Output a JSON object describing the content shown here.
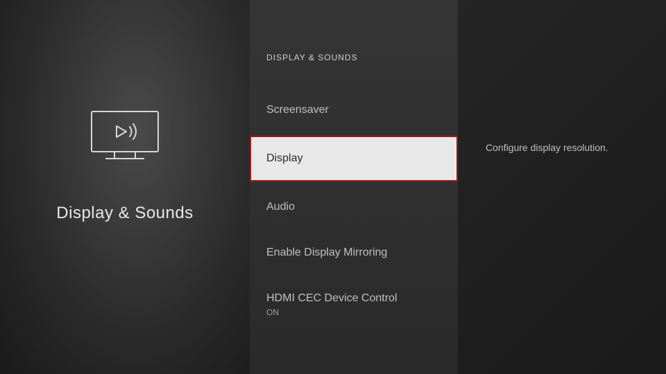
{
  "category": {
    "title": "Display & Sounds"
  },
  "menu": {
    "header": "DISPLAY & SOUNDS",
    "items": [
      {
        "label": "Screensaver",
        "sub": ""
      },
      {
        "label": "Display",
        "sub": ""
      },
      {
        "label": "Audio",
        "sub": ""
      },
      {
        "label": "Enable Display Mirroring",
        "sub": ""
      },
      {
        "label": "HDMI CEC Device Control",
        "sub": "ON"
      }
    ]
  },
  "detail": {
    "description": "Configure display resolution."
  }
}
